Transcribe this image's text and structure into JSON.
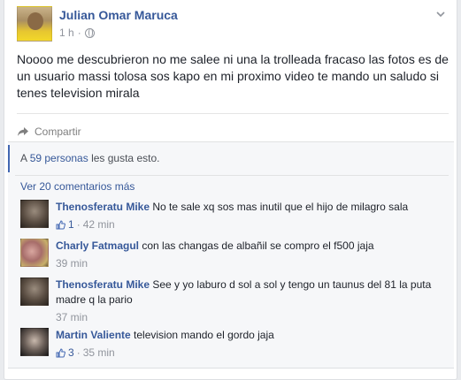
{
  "post": {
    "author": "Julian Omar Maruca",
    "time": "1 h",
    "dot": "·",
    "text": "Noooo me descubrieron no me salee ni una la trolleada fracaso las fotos es de un usuario massi tolosa sos kapo en mi proximo video te mando un saludo si tenes television mirala",
    "share_label": "Compartir"
  },
  "likes": {
    "prefix": "A",
    "count_link": "59 personas",
    "suffix": "les gusta esto."
  },
  "comments_section": {
    "view_more": "Ver 20 comentarios más",
    "comments": [
      {
        "author": "Thenosferatu Mike",
        "text": "No te sale xq sos mas inutil que el hijo de milagro sala",
        "likes": "1",
        "time": "42 min",
        "dot": "·"
      },
      {
        "author": "Charly Fatmagul",
        "text": "con las changas de albañil se compro el f500 jaja",
        "likes": "",
        "time": "39 min",
        "dot": ""
      },
      {
        "author": "Thenosferatu Mike",
        "text": "See y yo laburo d sol a sol y tengo un taunus del 81 la puta madre q la pario",
        "likes": "",
        "time": "37 min",
        "dot": ""
      },
      {
        "author": "Martin Valiente",
        "text": "television mando el gordo jaja",
        "likes": "3",
        "time": "35 min",
        "dot": "·"
      }
    ]
  },
  "colors": {
    "link": "#365899",
    "accent": "#4267b2",
    "muted": "#90949c",
    "background": "#e9ebee"
  },
  "icons": {
    "audience": "globe-icon",
    "menu": "chevron-down-icon",
    "share": "share-arrow-icon",
    "like": "thumbs-up-icon"
  }
}
